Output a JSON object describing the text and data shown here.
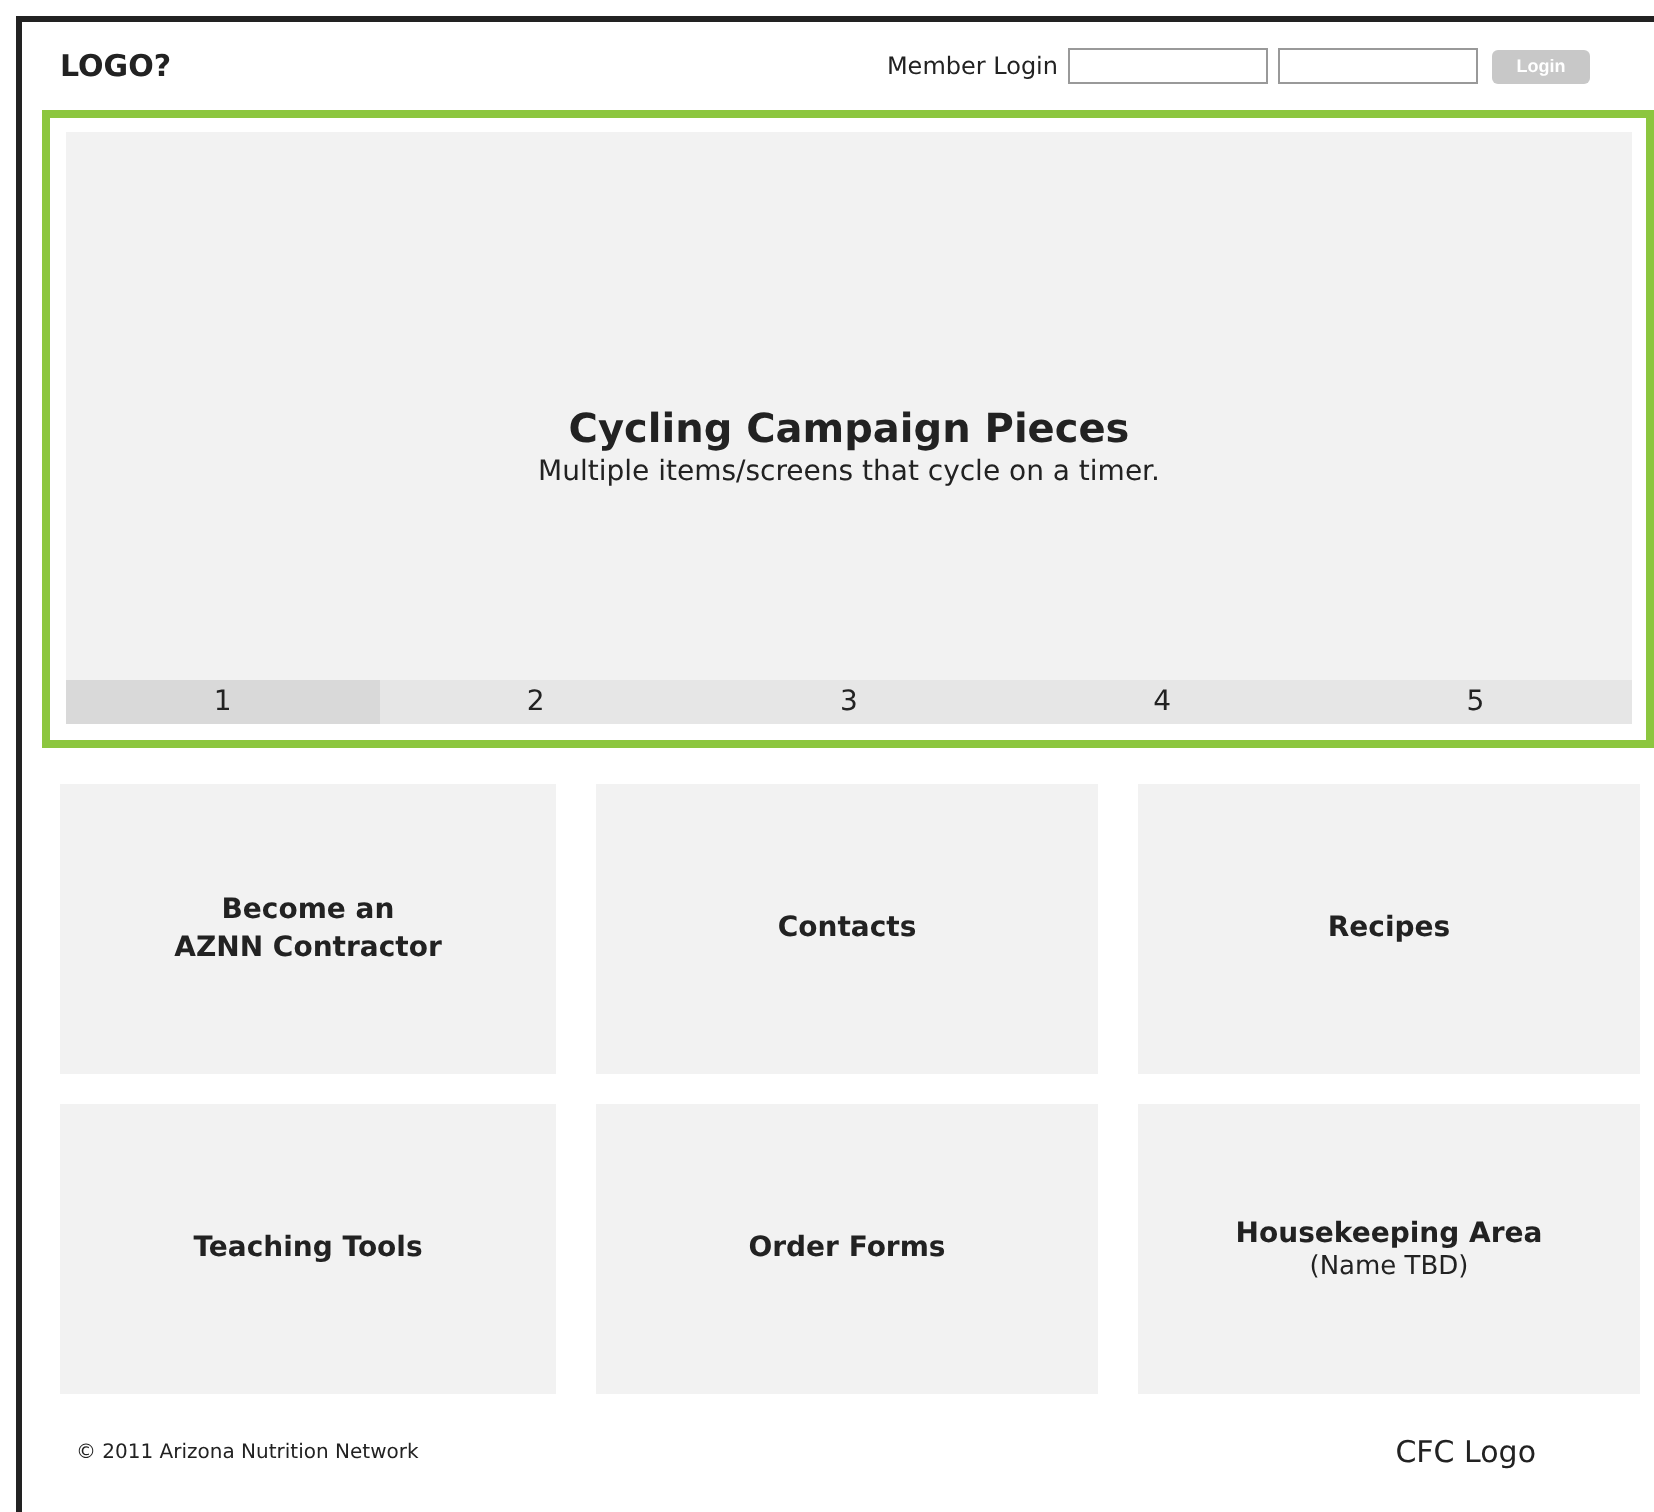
{
  "header": {
    "logo": "LOGO?",
    "login_label": "Member Login",
    "login_button": {
      "label": "Login",
      "disabled": true
    }
  },
  "carousel": {
    "title": "Cycling Campaign Pieces",
    "subtitle": "Multiple items/screens that cycle on a timer.",
    "pages": [
      {
        "label": "1",
        "selected": true
      },
      {
        "label": "2",
        "selected": false
      },
      {
        "label": "3",
        "selected": false
      },
      {
        "label": "4",
        "selected": false
      },
      {
        "label": "5",
        "selected": false
      }
    ]
  },
  "tiles": [
    {
      "title": "Become an\nAZNN Contractor"
    },
    {
      "title": "Contacts"
    },
    {
      "title": "Recipes"
    },
    {
      "title": "Teaching Tools"
    },
    {
      "title": "Order Forms"
    },
    {
      "title": "Housekeeping Area",
      "subtitle": "(Name TBD)"
    }
  ],
  "footer": {
    "copyright": "© 2011 Arizona Nutrition Network",
    "partner_logo": "CFC Logo"
  }
}
